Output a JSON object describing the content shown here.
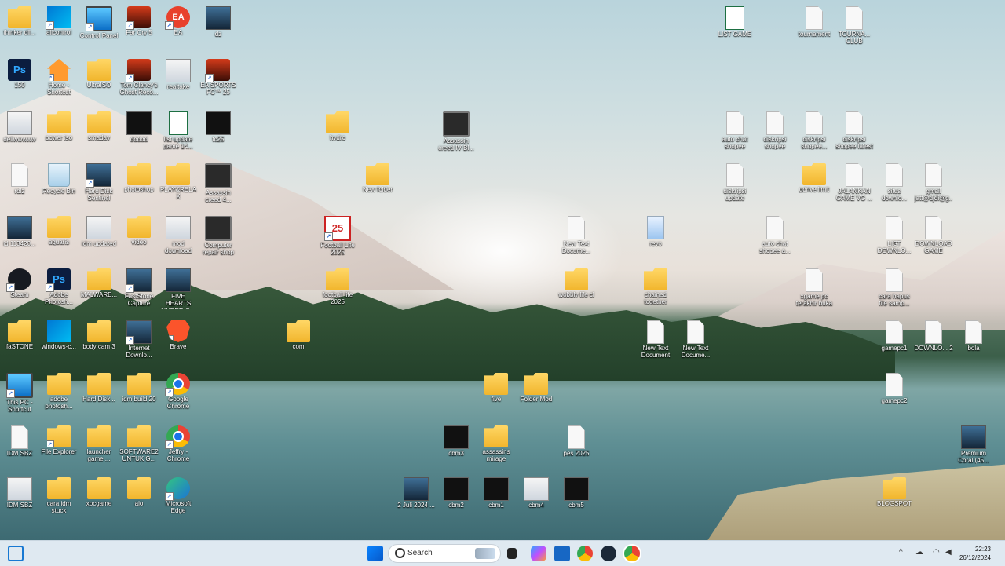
{
  "desktop": {
    "icons": [
      {
        "name": "thinker-dll-folder",
        "label": "thinker dll...",
        "type": "folder",
        "sc": false
      },
      {
        "name": "all-control",
        "label": "allcontrol",
        "type": "winctl",
        "sc": true
      },
      {
        "name": "control-panel",
        "label": "Control Panel",
        "type": "monitor",
        "sc": true
      },
      {
        "name": "far-cry-5",
        "label": "Far Cry 5",
        "type": "game",
        "sc": true
      },
      {
        "name": "ea",
        "label": "EA",
        "type": "ea",
        "sc": true
      },
      {
        "name": "dz",
        "label": "dz",
        "type": "img",
        "sc": false
      },
      {
        "name": "list-game",
        "label": "LIST GAME",
        "type": "excel",
        "sc": false
      },
      {
        "name": "tournament",
        "label": "tournament",
        "type": "doc",
        "sc": false
      },
      {
        "name": "tourna-club",
        "label": "TOURNA... CLUB",
        "type": "doc",
        "sc": false
      },
      {
        "name": "ps-150",
        "label": "150",
        "type": "ps",
        "sc": false
      },
      {
        "name": "home-shortcut",
        "label": "Home - Shortcut",
        "type": "home",
        "sc": true
      },
      {
        "name": "ultraiso",
        "label": "UltraISO",
        "type": "folder",
        "sc": false
      },
      {
        "name": "tom-clancys",
        "label": "Tom Clancy's Ghost Reco...",
        "type": "game",
        "sc": true
      },
      {
        "name": "realtake",
        "label": "realtake",
        "type": "exe",
        "sc": false
      },
      {
        "name": "ea-sports-fc25",
        "label": "EA SPORTS FC™ 25",
        "type": "game",
        "sc": true
      },
      {
        "name": "dellwww",
        "label": "dellwwwww",
        "type": "exe",
        "sc": false
      },
      {
        "name": "power-iso",
        "label": "power iso",
        "type": "folder",
        "sc": false
      },
      {
        "name": "smadav",
        "label": "smadav",
        "type": "folder",
        "sc": false
      },
      {
        "name": "ddddd",
        "label": "ddddd",
        "type": "dark",
        "sc": false
      },
      {
        "name": "list-update-game",
        "label": "list update game 14...",
        "type": "excel",
        "sc": false
      },
      {
        "name": "fc25",
        "label": "fc25",
        "type": "dark",
        "sc": false
      },
      {
        "name": "hydro",
        "label": "hydro",
        "type": "folder",
        "sc": false
      },
      {
        "name": "assassin-creed-iv",
        "label": "Assassin creed IV Bl...",
        "type": "video",
        "sc": false
      },
      {
        "name": "auto-chat-shopee",
        "label": "auto chat shopee",
        "type": "doc",
        "sc": false
      },
      {
        "name": "dikhripsi-shopee",
        "label": "diskripsi shopee",
        "type": "doc",
        "sc": false
      },
      {
        "name": "dikhripsi-shopee2",
        "label": "diskripsi shopee...",
        "type": "doc",
        "sc": false
      },
      {
        "name": "dikhripsi-shopee-latest",
        "label": "diskripsi shopee latest",
        "type": "doc",
        "sc": false
      },
      {
        "name": "rdlz",
        "label": "rdlz",
        "type": "doc",
        "sc": false
      },
      {
        "name": "recycle-bin",
        "label": "Recycle Bin",
        "type": "recycle",
        "sc": false
      },
      {
        "name": "hard-disk-sentinel",
        "label": "Hard Disk Sentinel",
        "type": "img",
        "sc": true
      },
      {
        "name": "photoshop-folder",
        "label": "photoshop",
        "type": "folder",
        "sc": false
      },
      {
        "name": "play-relax",
        "label": "PLAY&RELAX",
        "type": "folder",
        "sc": false
      },
      {
        "name": "assassin-creed-4",
        "label": "Assassin creed 4...",
        "type": "video",
        "sc": false
      },
      {
        "name": "new-folder",
        "label": "New folder",
        "type": "folder",
        "sc": false
      },
      {
        "name": "diskripsi-update",
        "label": "diskripsi update",
        "type": "doc",
        "sc": false
      },
      {
        "name": "gdrive-limit",
        "label": "gdrive limit",
        "type": "folder",
        "sc": false
      },
      {
        "name": "jalankan-game",
        "label": "JALANKAN GAME VG ...",
        "type": "doc",
        "sc": false
      },
      {
        "name": "situs-download",
        "label": "situs downlo...",
        "type": "doc",
        "sc": false
      },
      {
        "name": "gmail",
        "label": "gmail jatt@djdi@g...",
        "type": "doc",
        "sc": false
      },
      {
        "name": "id-11342",
        "label": "id 113420...",
        "type": "img",
        "sc": false
      },
      {
        "name": "aquaris",
        "label": "aquaris",
        "type": "folder",
        "sc": false
      },
      {
        "name": "idm-updated",
        "label": "idm updated",
        "type": "exe",
        "sc": false
      },
      {
        "name": "video-folder",
        "label": "video",
        "type": "folder",
        "sc": false
      },
      {
        "name": "mod-download",
        "label": "mod download",
        "type": "exe",
        "sc": false
      },
      {
        "name": "computer-repair-shop",
        "label": "Computer repair shop",
        "type": "video",
        "sc": false
      },
      {
        "name": "football-life-2025",
        "label": "Football Life 2025",
        "type": "fl25",
        "sc": true
      },
      {
        "name": "new-text-doc-1",
        "label": "New Text Docume...",
        "type": "doc",
        "sc": false
      },
      {
        "name": "revo",
        "label": "revo",
        "type": "docimg",
        "sc": false
      },
      {
        "name": "auto-chat-shopee-a",
        "label": "auto chat shopee a...",
        "type": "doc",
        "sc": false
      },
      {
        "name": "list-download",
        "label": "LIST DOWNLO...",
        "type": "doc",
        "sc": false
      },
      {
        "name": "download-game",
        "label": "DOWNLOAD GAME",
        "type": "doc",
        "sc": false
      },
      {
        "name": "steam",
        "label": "Steam",
        "type": "steam",
        "sc": true
      },
      {
        "name": "adobe-photoshop",
        "label": "Adobe Photosh...",
        "type": "ps",
        "sc": true
      },
      {
        "name": "malware",
        "label": "MALWARE...",
        "type": "folder",
        "sc": false
      },
      {
        "name": "faststone-capture",
        "label": "FastStone Capture",
        "type": "img",
        "sc": true
      },
      {
        "name": "five-hearts",
        "label": "FIVE HEARTS UNDER O...",
        "type": "img",
        "sc": false
      },
      {
        "name": "football-life-2025-folder",
        "label": "football life 2025",
        "type": "folder",
        "sc": false
      },
      {
        "name": "wobbly-life",
        "label": "wobbly life cl",
        "type": "folder",
        "sc": false
      },
      {
        "name": "chained-together",
        "label": "chained together",
        "type": "folder",
        "sc": false
      },
      {
        "name": "xgame-pc",
        "label": "xgame pc terakhir buka",
        "type": "doc",
        "sc": false
      },
      {
        "name": "cara-hapus",
        "label": "cara hapus file samp...",
        "type": "doc",
        "sc": false
      },
      {
        "name": "fastone",
        "label": "faSTONE",
        "type": "folder",
        "sc": false
      },
      {
        "name": "windows-c",
        "label": "windows-c...",
        "type": "winctl",
        "sc": false
      },
      {
        "name": "body-cam-3",
        "label": "body cam 3",
        "type": "folder",
        "sc": false
      },
      {
        "name": "internet-download",
        "label": "Internet Downlo...",
        "type": "img",
        "sc": true
      },
      {
        "name": "brave",
        "label": "Brave",
        "type": "brave",
        "sc": true
      },
      {
        "name": "com",
        "label": "com",
        "type": "folder",
        "sc": false
      },
      {
        "name": "new-text-document",
        "label": "New Text Document",
        "type": "doc",
        "sc": false
      },
      {
        "name": "new-text-docume-2",
        "label": "New Text Docume...",
        "type": "doc",
        "sc": false
      },
      {
        "name": "gamepc1",
        "label": "gamepc1",
        "type": "doc",
        "sc": false
      },
      {
        "name": "download-2",
        "label": "DOWNLO... 2",
        "type": "doc",
        "sc": false
      },
      {
        "name": "bola",
        "label": "bola",
        "type": "doc",
        "sc": false
      },
      {
        "name": "this-pc",
        "label": "This PC - Shortcut",
        "type": "monitor",
        "sc": true
      },
      {
        "name": "adobe-photoshop-folder",
        "label": "adobe photosh...",
        "type": "folder",
        "sc": false
      },
      {
        "name": "hard-disk-folder",
        "label": "Hard Disk...",
        "type": "folder",
        "sc": false
      },
      {
        "name": "idm-build",
        "label": "idm build 20",
        "type": "folder",
        "sc": false
      },
      {
        "name": "google-chrome",
        "label": "Google Chrome",
        "type": "chrome",
        "sc": true
      },
      {
        "name": "five",
        "label": "five",
        "type": "folder",
        "sc": false
      },
      {
        "name": "folder-mod",
        "label": "Folder Mod",
        "type": "folder",
        "sc": false
      },
      {
        "name": "gamepc2",
        "label": "gamepc2",
        "type": "doc",
        "sc": false
      },
      {
        "name": "idm-sbz",
        "label": "IDM SBZ",
        "type": "doc",
        "sc": false
      },
      {
        "name": "file-explorer",
        "label": "File Explorer",
        "type": "folder",
        "sc": true
      },
      {
        "name": "launcher-game",
        "label": "launcher game ...",
        "type": "folder",
        "sc": false
      },
      {
        "name": "software2",
        "label": "SOFTWARE2 UNTUK G...",
        "type": "folder",
        "sc": false
      },
      {
        "name": "jeffry-chrome",
        "label": "Jeffry - Chrome",
        "type": "chrome",
        "sc": true
      },
      {
        "name": "cbm3",
        "label": "cbm3",
        "type": "dark",
        "sc": false
      },
      {
        "name": "assassins-mirage",
        "label": "assassins mirage",
        "type": "folder",
        "sc": false
      },
      {
        "name": "pes-2025",
        "label": "pes 2025",
        "type": "doc",
        "sc": false
      },
      {
        "name": "premium-coral",
        "label": "Premium Coral (45...",
        "type": "img",
        "sc": false
      },
      {
        "name": "idm-sbz-2",
        "label": "IDM SBZ",
        "type": "exe",
        "sc": false
      },
      {
        "name": "cara-idm-stuck",
        "label": "cara idm stuck",
        "type": "folder",
        "sc": false
      },
      {
        "name": "xpcgame",
        "label": "xpcgame",
        "type": "folder",
        "sc": false
      },
      {
        "name": "aio",
        "label": "aio",
        "type": "folder",
        "sc": false
      },
      {
        "name": "microsoft-edge",
        "label": "Microsoft Edge",
        "type": "edge",
        "sc": true
      },
      {
        "name": "2-juli-2024",
        "label": "2 Juli 2024 ...",
        "type": "img",
        "sc": false
      },
      {
        "name": "cbm2",
        "label": "cbm2",
        "type": "dark",
        "sc": false
      },
      {
        "name": "cbm1",
        "label": "cbm1",
        "type": "dark",
        "sc": false
      },
      {
        "name": "cbm4",
        "label": "cbm4",
        "type": "exe",
        "sc": false
      },
      {
        "name": "cbm5",
        "label": "cbm5",
        "type": "dark",
        "sc": false
      },
      {
        "name": "blogspot",
        "label": "BLOGSPOT",
        "type": "folder",
        "sc": false
      }
    ]
  },
  "taskbar": {
    "search_placeholder": "Search",
    "apps": [
      "widgets-icon",
      "start-icon",
      "search-icon",
      "task-view-icon",
      "file-explorer-icon",
      "copilot-icon",
      "store-icon",
      "chrome-icon",
      "steam-icon",
      "chrome-profile-icon"
    ],
    "tray": {
      "chevron": "^",
      "time": "22:23",
      "date": "26/12/2024"
    }
  }
}
